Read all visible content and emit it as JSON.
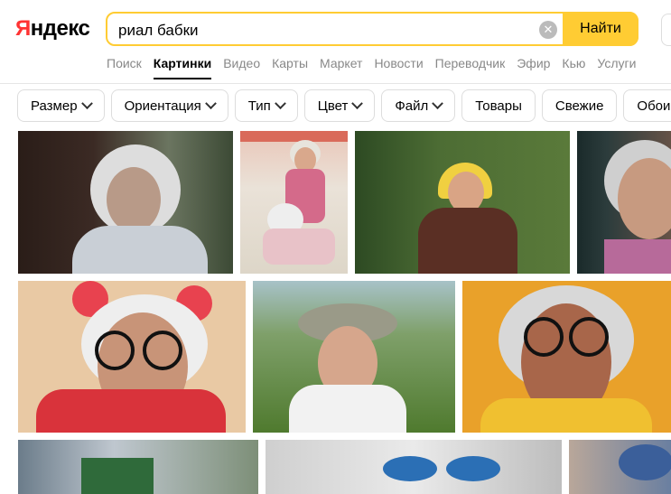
{
  "logo": {
    "first_letter": "Я",
    "rest": "ндекс"
  },
  "search": {
    "query": "риал бабки",
    "button_label": "Найти",
    "clear_glyph": "✕"
  },
  "tabs": [
    {
      "label": "Поиск",
      "active": false
    },
    {
      "label": "Картинки",
      "active": true
    },
    {
      "label": "Видео",
      "active": false
    },
    {
      "label": "Карты",
      "active": false
    },
    {
      "label": "Маркет",
      "active": false
    },
    {
      "label": "Новости",
      "active": false
    },
    {
      "label": "Переводчик",
      "active": false
    },
    {
      "label": "Эфир",
      "active": false
    },
    {
      "label": "Кью",
      "active": false
    },
    {
      "label": "Услуги",
      "active": false
    }
  ],
  "filters": [
    {
      "label": "Размер",
      "dropdown": true
    },
    {
      "label": "Ориентация",
      "dropdown": true
    },
    {
      "label": "Тип",
      "dropdown": true
    },
    {
      "label": "Цвет",
      "dropdown": true
    },
    {
      "label": "Файл",
      "dropdown": true
    },
    {
      "label": "Товары",
      "dropdown": false
    },
    {
      "label": "Свежие",
      "dropdown": false
    },
    {
      "label": "Обои",
      "dropdown": false
    }
  ],
  "colors": {
    "accent": "#ffcc33",
    "logo_red": "#ff3333",
    "tab_inactive": "#888888"
  }
}
